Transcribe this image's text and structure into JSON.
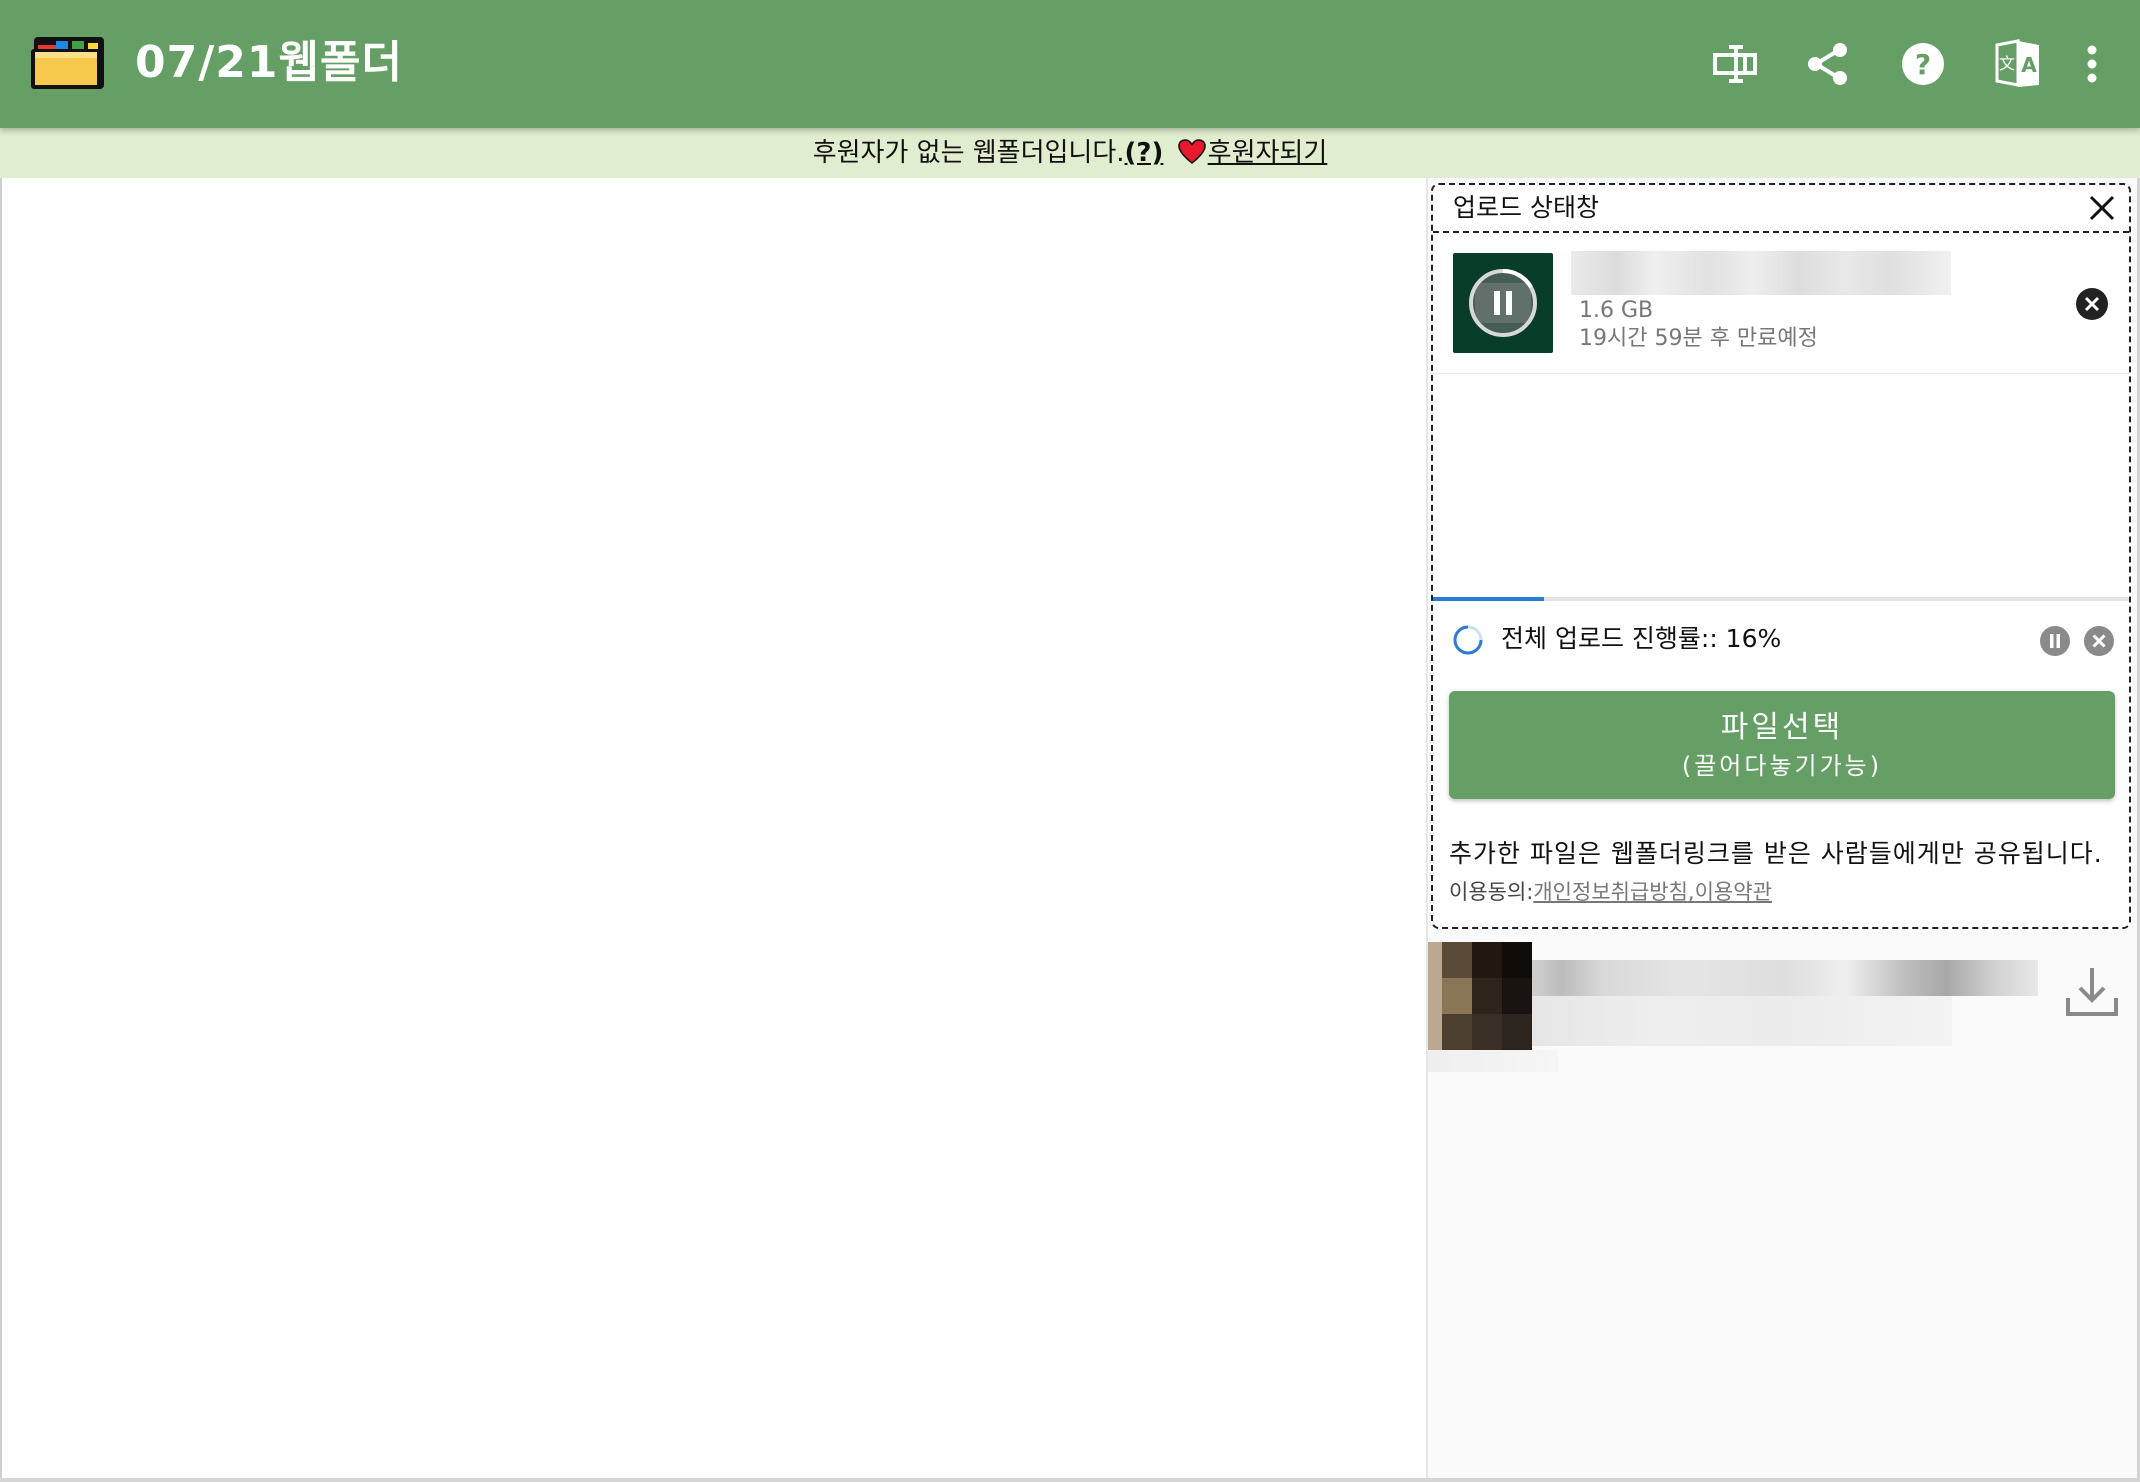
{
  "header": {
    "title": "07/21웹폴더",
    "icons": [
      "folder-logo-icon",
      "rename-icon",
      "share-icon",
      "help-icon",
      "translate-icon",
      "more-vert-icon"
    ]
  },
  "sponsor_bar": {
    "text": "후원자가 없는 웹폴더입니다.",
    "question": "(?)",
    "link": "후원자되기",
    "heart_color": "#e8192c"
  },
  "upload_window": {
    "title": "업로드 상태창",
    "item": {
      "size": "1.6 GB",
      "expiry": "19시간 59분 후 만료예정"
    },
    "total_label": "전체 업로드 진행률:: 16%",
    "progress_percent": 16,
    "select_button": {
      "line1": "파일선택",
      "line2": "(끌어다놓기가능)"
    },
    "notice": "추가한 파일은 웹폴더링크를 받은 사람들에게만 공유됩니다.",
    "agree_prefix": "이용동의:",
    "privacy_link": "개인정보취급방침",
    "separator": ",",
    "terms_link": "이용약관"
  },
  "colors": {
    "header_bg": "#659f65",
    "sponsor_bg": "#e0edce",
    "progress": "#2a7bd1"
  }
}
